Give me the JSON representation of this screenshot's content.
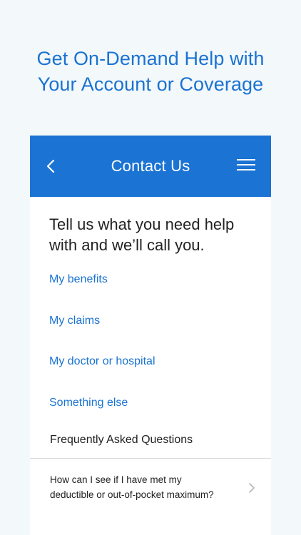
{
  "promo": {
    "title_line1": "Get On-Demand Help with",
    "title_line2": "Your Account or Coverage"
  },
  "header": {
    "title": "Contact Us",
    "back_icon": "chevron-left-icon",
    "menu_icon": "hamburger-menu-icon"
  },
  "intro": {
    "line1": "Tell us what you need help",
    "line2": "with and we’ll call you."
  },
  "options": [
    {
      "label": "My benefits"
    },
    {
      "label": "My claims"
    },
    {
      "label": "My doctor or hospital"
    },
    {
      "label": "Something else"
    }
  ],
  "faq": {
    "heading": "Frequently Asked Questions",
    "items": [
      {
        "line1": "How can I see if I have met my",
        "line2": "deductible or out-of-pocket maximum?"
      }
    ]
  },
  "colors": {
    "brand_blue": "#1b73d3",
    "link_blue": "#1a73d1",
    "page_background": "#f3f8fb"
  }
}
